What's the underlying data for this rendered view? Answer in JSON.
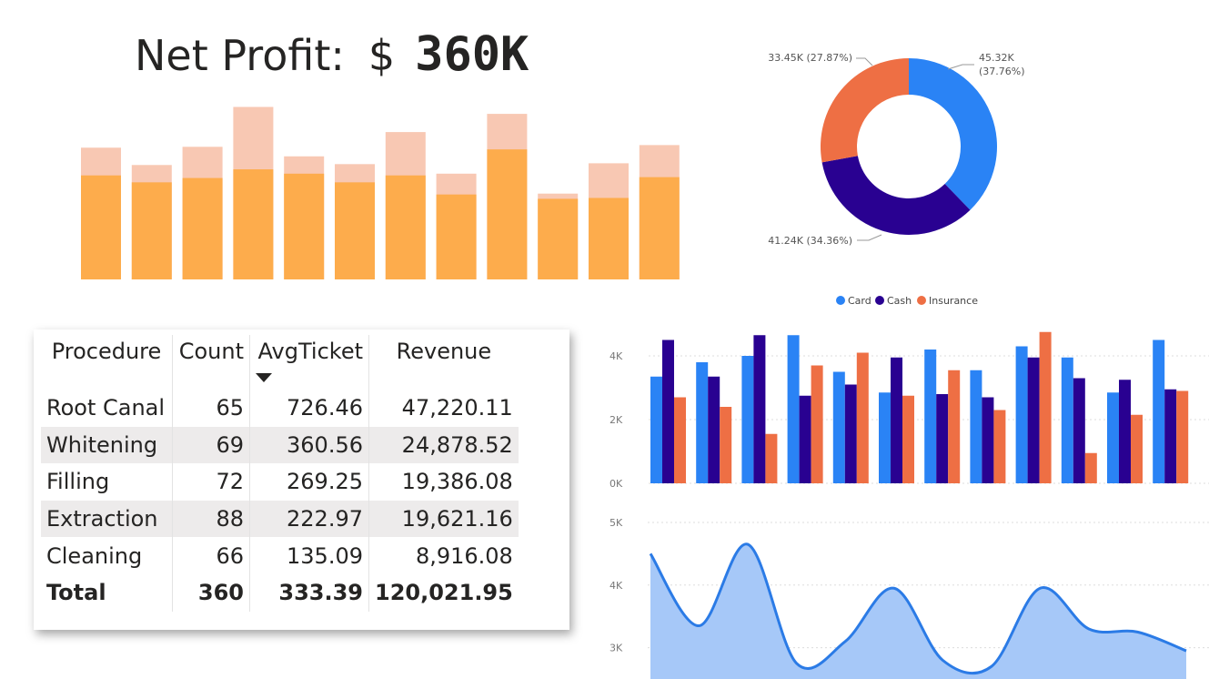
{
  "kpi": {
    "label": "Net Profit:",
    "currency": "$",
    "value": "360K"
  },
  "colors": {
    "bar_front": "#fdac4c",
    "bar_back": "#f8c8b3",
    "card": "#2a83f5",
    "cash": "#290191",
    "insurance": "#ee6f44",
    "area_line": "#2b7be6",
    "area_fill": "#a6c8f8"
  },
  "chart_data": [
    {
      "type": "bar",
      "title": "",
      "series": [
        {
          "values": [
            120,
            112,
            117,
            127,
            122,
            112,
            120,
            98,
            150,
            93,
            94,
            118
          ]
        },
        {
          "values": [
            152,
            132,
            153,
            199,
            142,
            133,
            170,
            122,
            191,
            99,
            134,
            155
          ]
        }
      ],
      "ylim": [
        0,
        210
      ],
      "grid": false
    },
    {
      "type": "pie",
      "subtype": "donut",
      "labels": [
        "Card",
        "Cash",
        "Insurance"
      ],
      "values": [
        45.32,
        41.24,
        33.45
      ],
      "data_labels": [
        "45.32K\n(37.76%)",
        "41.24K (34.36%)",
        "33.45K (27.87%)"
      ],
      "legend": "bottom"
    },
    {
      "type": "bar",
      "series": [
        {
          "name": "Card",
          "values": [
            3.35,
            3.8,
            4.0,
            4.65,
            3.5,
            2.85,
            4.2,
            3.55,
            4.3,
            3.95,
            2.85,
            4.5
          ]
        },
        {
          "name": "Cash",
          "values": [
            4.5,
            3.35,
            4.65,
            2.75,
            3.1,
            3.95,
            2.8,
            2.7,
            3.95,
            3.3,
            3.25,
            2.95
          ]
        },
        {
          "name": "Insurance",
          "values": [
            2.7,
            2.4,
            1.55,
            3.7,
            4.1,
            2.75,
            3.55,
            2.3,
            4.75,
            0.95,
            2.15,
            2.9
          ]
        }
      ],
      "y_ticks": [
        "0K",
        "2K",
        "4K"
      ],
      "ylim": [
        0,
        5
      ],
      "grid": true,
      "legend": "top-center"
    },
    {
      "type": "area",
      "x": [
        1,
        2,
        3,
        4,
        5,
        6,
        7,
        8,
        9,
        10,
        11,
        12
      ],
      "y": [
        4.5,
        3.35,
        4.65,
        2.75,
        3.1,
        3.95,
        2.8,
        2.7,
        3.95,
        3.3,
        3.25,
        2.95
      ],
      "y_ticks": [
        "3K",
        "4K",
        "5K"
      ],
      "ylim": [
        2.5,
        5
      ],
      "grid": true
    }
  ],
  "table": {
    "columns": [
      "Procedure",
      "Count",
      "AvgTicket",
      "Revenue"
    ],
    "rows": [
      [
        "Root Canal",
        "65",
        "726.46",
        "47,220.11"
      ],
      [
        "Whitening",
        "69",
        "360.56",
        "24,878.52"
      ],
      [
        "Filling",
        "72",
        "269.25",
        "19,386.08"
      ],
      [
        "Extraction",
        "88",
        "222.97",
        "19,621.16"
      ],
      [
        "Cleaning",
        "66",
        "135.09",
        "8,916.08"
      ]
    ],
    "total": [
      "Total",
      "360",
      "333.39",
      "120,021.95"
    ],
    "sort_icon": "sort-descending-icon"
  }
}
